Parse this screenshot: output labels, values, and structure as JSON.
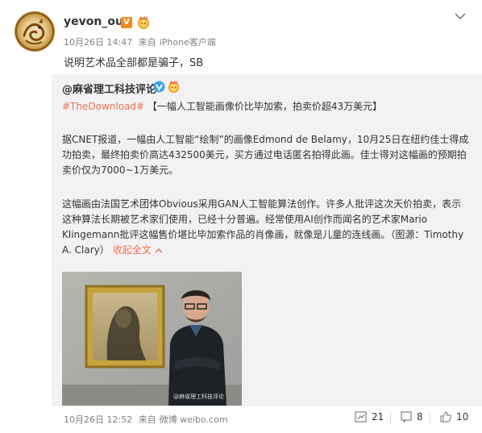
{
  "author": {
    "username": "yevon_ou",
    "verified_badge": "V",
    "timestamp": "10月26日 14:47",
    "source_prefix": "来自",
    "source": "iPhone客户端"
  },
  "post": {
    "text": "说明艺术品全部都是骗子，SB"
  },
  "repost": {
    "author": "@麻省理工科技评论",
    "tag": "#TheDownload#",
    "headline": "【一幅人工智能画像价比毕加索，拍卖价超43万美元】",
    "paragraph1": "据CNET报道，一幅由人工智能“绘制”的画像Edmond de Belamy，10月25日在纽约佳士得成功拍卖，最终拍卖价高达432500美元，买方通过电话匿名拍得此画。佳士得对这幅画的预期拍卖价仅为7000~1万美元。",
    "paragraph2": "这幅画由法国艺术团体Obvious采用GAN人工智能算法创作。许多人批评这次天价拍卖，表示这种算法长期被艺术家们使用，已经十分普遍。经常使用AI创作而闻名的艺术家Mario Klingemann批评这幅售价堪比毕加索作品的肖像画，就像是儿童的连线画。（图源：Timothy A. Clary）",
    "collapse_label": "收起全文",
    "image_watermark": "@麻省理工科技评论",
    "timestamp": "10月26日 12:52",
    "source_prefix": "来自",
    "source": "微博 weibo.com",
    "repost_count": "21",
    "comment_count": "8",
    "like_count": "10"
  },
  "icons": {
    "chevron": "chevron-down-icon",
    "repost": "repost-icon",
    "comment": "comment-icon",
    "like": "like-icon",
    "verified": "verified-icon",
    "member": "member-crown-icon"
  },
  "colors": {
    "link_orange": "#eb7350",
    "vip_orange": "#f28b1c",
    "verified_blue": "#3fa3e8",
    "repost_bg": "#f2f2f5",
    "meta_gray": "#808080"
  }
}
